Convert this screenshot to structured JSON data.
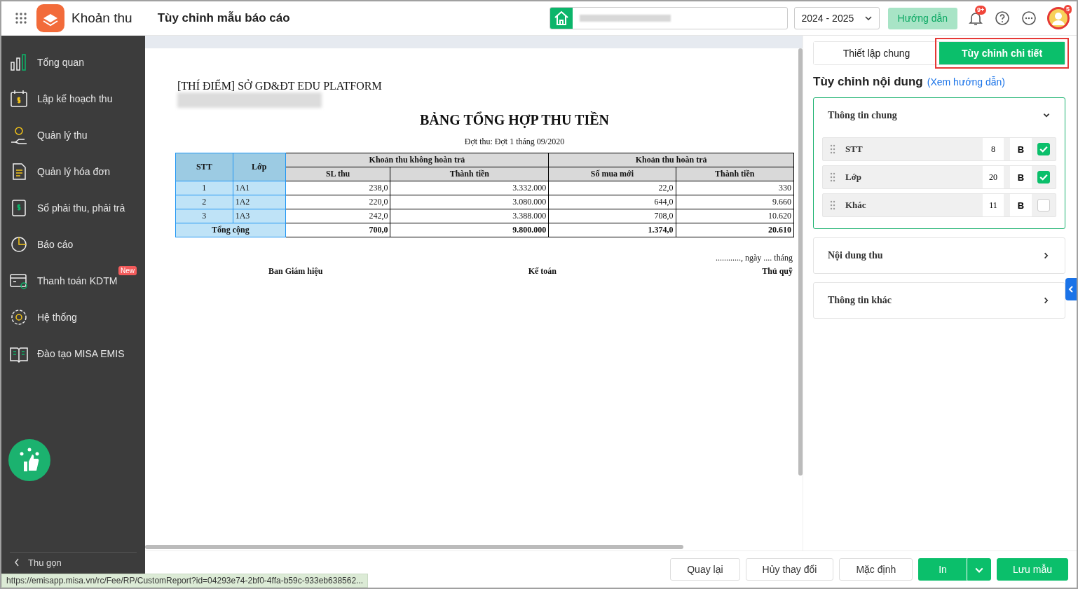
{
  "header": {
    "app_name": "Khoản thu",
    "page_title": "Tùy chỉnh mẫu báo cáo",
    "school_year": "2024 - 2025",
    "guide_button": "Hướng dẫn",
    "notification_badge": "9+",
    "avatar_badge": "5"
  },
  "sidebar": {
    "items": [
      {
        "label": "Tổng quan"
      },
      {
        "label": "Lập kế hoạch thu"
      },
      {
        "label": "Quản lý thu"
      },
      {
        "label": "Quản lý hóa đơn"
      },
      {
        "label": "Sổ phải thu, phải trả"
      },
      {
        "label": "Báo cáo"
      },
      {
        "label": "Thanh toán KDTM",
        "badge": "New"
      },
      {
        "label": "Hệ thống"
      },
      {
        "label": "Đào tạo MISA EMIS"
      }
    ],
    "collapse": "Thu gọn"
  },
  "report": {
    "org": "[THÍ ĐIỂM] SỞ GD&ĐT EDU PLATFORM",
    "title": "BẢNG TỔNG HỢP THU TIỀN",
    "subtitle": "Đợt thu: Đợt 1 tháng 09/2020",
    "columns": {
      "stt": "STT",
      "class": "Lớp",
      "group_1": "Khoản thu không hoàn trả",
      "group_2": "Khoản thu hoàn trả",
      "sub": [
        "SL thu",
        "Thành tiền",
        "Số mua mới",
        "Thành tiền"
      ]
    },
    "rows": [
      {
        "stt": "1",
        "class": "1A1",
        "values": [
          "238,0",
          "3.332.000",
          "22,0",
          "330"
        ]
      },
      {
        "stt": "2",
        "class": "1A2",
        "values": [
          "220,0",
          "3.080.000",
          "644,0",
          "9.660"
        ]
      },
      {
        "stt": "3",
        "class": "1A3",
        "values": [
          "242,0",
          "3.388.000",
          "708,0",
          "10.620"
        ]
      }
    ],
    "total": {
      "label": "Tổng cộng",
      "values": [
        "700,0",
        "9.800.000",
        "1.374,0",
        "20.610"
      ]
    },
    "date_line": "............, ngày .... tháng",
    "signers": [
      "Ban Giám hiệu",
      "Kế toán",
      "Thủ quỹ"
    ]
  },
  "panel": {
    "tabs": [
      {
        "label": "Thiết lập chung",
        "selected": false
      },
      {
        "label": "Tùy chỉnh chi tiết",
        "selected": true
      }
    ],
    "heading": "Tùy chỉnh nội dung",
    "guide_link": "(Xem hướng dẫn)",
    "sections": [
      {
        "title": "Thông tin chung",
        "expanded": true,
        "fields": [
          {
            "name": "STT",
            "size": "8",
            "bold": "B",
            "checked": true
          },
          {
            "name": "Lớp",
            "size": "20",
            "bold": "B",
            "checked": true
          },
          {
            "name": "Khác",
            "size": "11",
            "bold": "B",
            "checked": false
          }
        ]
      },
      {
        "title": "Nội dung thu",
        "expanded": false
      },
      {
        "title": "Thông tin khác",
        "expanded": false
      }
    ]
  },
  "footer": {
    "buttons": [
      {
        "label": "Quay lại",
        "kind": "plain"
      },
      {
        "label": "Hủy thay đổi",
        "kind": "plain"
      },
      {
        "label": "Mặc định",
        "kind": "plain"
      },
      {
        "label": "In",
        "kind": "split"
      },
      {
        "label": "Lưu mẫu",
        "kind": "primary"
      }
    ]
  },
  "status_url": "https://emisapp.misa.vn/rc/Fee/RP/CustomReport?id=04293e74-2bf0-4ffa-b59c-933eb638562..."
}
